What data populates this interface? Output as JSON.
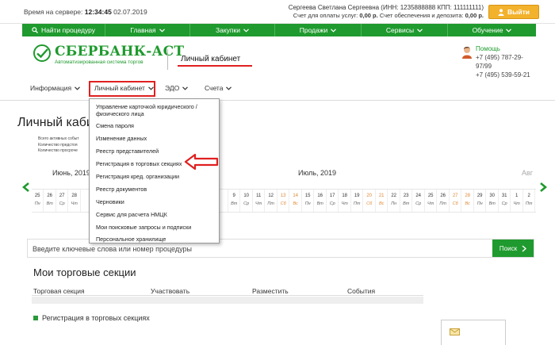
{
  "header": {
    "server_time_label": "Время на сервере:",
    "server_time": "12:34:45",
    "server_date": "02.07.2019",
    "user_line": "Сергеева Светлана Сергеевна (ИНН: 1235888888 КПП: 111111111)",
    "balance_label_1": "Счет для оплаты услуг:",
    "balance_value_1": "0,00 р.",
    "balance_label_2": "Счет обеспечения и депозита:",
    "balance_value_2": "0,00 р.",
    "logout_label": "Выйти"
  },
  "main_nav": [
    {
      "label": "Найти процедуру",
      "icon": "search-icon"
    },
    {
      "label": "Главная"
    },
    {
      "label": "Закупки"
    },
    {
      "label": "Продажи"
    },
    {
      "label": "Сервисы"
    },
    {
      "label": "Обучение"
    }
  ],
  "brand": {
    "name": "СБЕРБАНК-АСТ",
    "tagline": "Автоматизированная система торгов",
    "cabinet_label": "Личный кабинет",
    "brand_color": "#1f9a2e"
  },
  "help": {
    "label": "Помощь",
    "phone_1": "+7 (495) 787-29-97/99",
    "phone_2": "+7 (495) 539-59-21"
  },
  "sub_nav": [
    {
      "label": "Информация"
    },
    {
      "label": "Личный кабинет",
      "active": true
    },
    {
      "label": "ЭДО"
    },
    {
      "label": "Счета"
    }
  ],
  "dropdown": {
    "items": [
      "Управление карточкой юридического / физического лица",
      "Смена пароля",
      "Изменение данных",
      "Реестр представителей",
      "Регистрация в торговых секциях",
      "Регистрация кред. организации",
      "Реестр документов",
      "Черновики",
      "Сервис для расчета НМЦК",
      "Мои поисковые запросы и подписки",
      "Персональное хранилище"
    ],
    "highlighted_index": 4,
    "highlight_color": "#e02020"
  },
  "page": {
    "title": "Личный каби",
    "stats": [
      "Всего активных событ",
      "Количество предстоя",
      "Количество просроче"
    ]
  },
  "calendar": {
    "months": [
      "Июнь, 2019",
      "Июль, 2019",
      "Авг"
    ],
    "days": [
      {
        "n": "25",
        "w": "Пн"
      },
      {
        "n": "26",
        "w": "Вт"
      },
      {
        "n": "27",
        "w": "Ср"
      },
      {
        "n": "28",
        "w": "Чт"
      },
      {
        "n": "",
        "w": ""
      },
      {
        "n": "",
        "w": ""
      },
      {
        "n": "",
        "w": ""
      },
      {
        "n": "",
        "w": ""
      },
      {
        "n": "",
        "w": ""
      },
      {
        "n": "",
        "w": ""
      },
      {
        "n": "",
        "w": ""
      },
      {
        "n": "",
        "w": ""
      },
      {
        "n": "",
        "w": ""
      },
      {
        "n": "",
        "w": ""
      },
      {
        "n": "",
        "w": ""
      },
      {
        "n": "",
        "w": ""
      },
      {
        "n": "9",
        "w": "Вт"
      },
      {
        "n": "10",
        "w": "Ср"
      },
      {
        "n": "11",
        "w": "Чт"
      },
      {
        "n": "12",
        "w": "Пт"
      },
      {
        "n": "13",
        "w": "Сб",
        "weekend": true
      },
      {
        "n": "14",
        "w": "Вс",
        "weekend": true
      },
      {
        "n": "15",
        "w": "Пн"
      },
      {
        "n": "16",
        "w": "Вт"
      },
      {
        "n": "17",
        "w": "Ср"
      },
      {
        "n": "18",
        "w": "Чт"
      },
      {
        "n": "19",
        "w": "Пт"
      },
      {
        "n": "20",
        "w": "Сб",
        "weekend": true
      },
      {
        "n": "21",
        "w": "Вс",
        "weekend": true
      },
      {
        "n": "22",
        "w": "Пн"
      },
      {
        "n": "23",
        "w": "Вт"
      },
      {
        "n": "24",
        "w": "Ср"
      },
      {
        "n": "25",
        "w": "Чт"
      },
      {
        "n": "26",
        "w": "Пт"
      },
      {
        "n": "27",
        "w": "Сб",
        "weekend": true
      },
      {
        "n": "28",
        "w": "Вс",
        "weekend": true
      },
      {
        "n": "29",
        "w": "Пн"
      },
      {
        "n": "30",
        "w": "Вт"
      },
      {
        "n": "31",
        "w": "Ср"
      },
      {
        "n": "1",
        "w": "Чт"
      },
      {
        "n": "2",
        "w": "Пт"
      }
    ]
  },
  "search": {
    "placeholder": "Введите ключевые слова или номер процедуры",
    "button_label": "Поиск"
  },
  "sections": {
    "title": "Мои торговые секции",
    "columns": [
      "Торговая секция",
      "Участвовать",
      "Разместить",
      "События"
    ],
    "register_link": "Регистрация в торговых секциях"
  }
}
